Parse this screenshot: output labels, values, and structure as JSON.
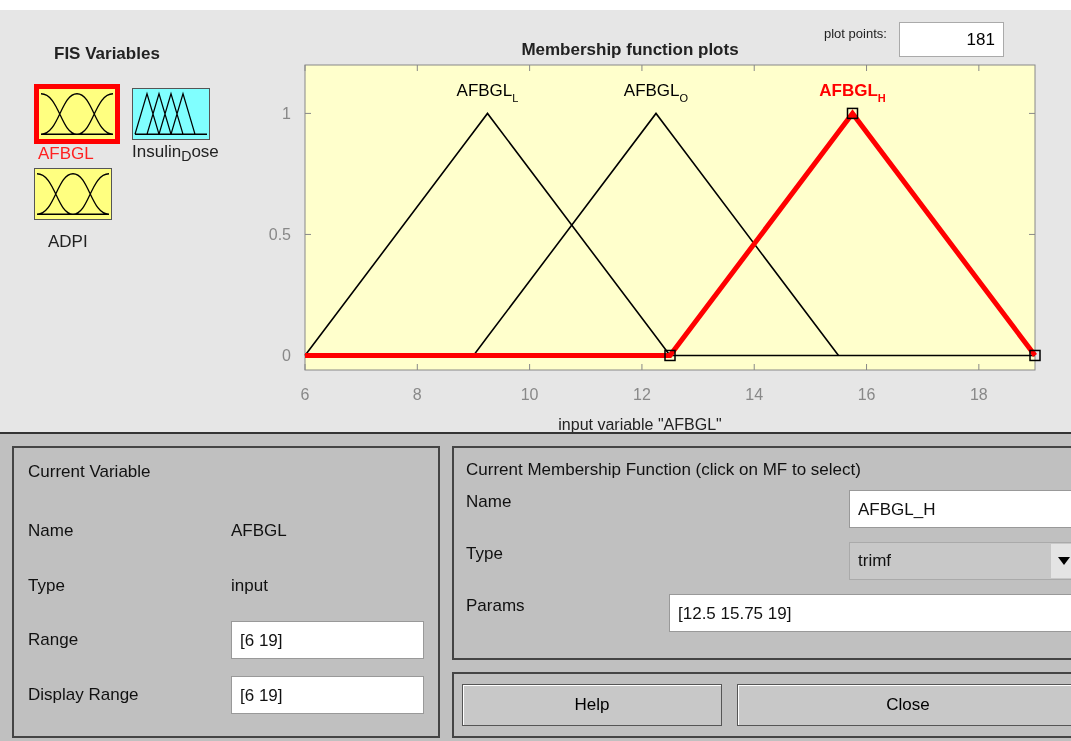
{
  "fis_variables": {
    "title": "FIS Variables",
    "items": [
      {
        "label": "AFBGL",
        "kind": "input",
        "color": "#ffff80",
        "selected": true
      },
      {
        "label": "Insulin$_{D}$ose",
        "kind": "output",
        "color": "#80ffff",
        "selected": false
      },
      {
        "label": "ADPI",
        "kind": "input",
        "color": "#ffff80",
        "selected": false
      }
    ]
  },
  "plot_points": {
    "label": "plot points:",
    "value": "181"
  },
  "chart_data": {
    "type": "line",
    "title": "Membership function plots",
    "xlabel": "input variable \"AFBGL\"",
    "x": [
      6,
      9,
      9.25,
      12.25,
      12.5,
      15.5,
      15.75,
      19
    ],
    "xlim": [
      6,
      19
    ],
    "ylim": [
      -0.06,
      1.2
    ],
    "xticks": [
      6,
      8,
      10,
      12,
      14,
      16,
      18
    ],
    "yticks": [
      0,
      0.5,
      1
    ],
    "series": [
      {
        "name": "AFBGL$_{L}$",
        "color": "#000000",
        "values": [
          0,
          0.923,
          1,
          0.077,
          0,
          null,
          null,
          null
        ]
      },
      {
        "name": "AFBGL$_{O}$",
        "color": "#000000",
        "values": [
          0,
          0,
          0.077,
          1,
          0.923,
          0,
          null,
          null
        ]
      },
      {
        "name": "AFBGL$_{H}$",
        "color": "#ff0000",
        "values": [
          0,
          0,
          0,
          0,
          0,
          0.923,
          1,
          0
        ]
      }
    ]
  },
  "curves": [
    {
      "selected": false
    },
    {
      "selected": false
    },
    {
      "selected": true
    }
  ],
  "current_variable": {
    "title": "Current Variable",
    "rows": [
      {
        "label": "Name",
        "kind": "text",
        "value": "AFBGL"
      },
      {
        "label": "Type",
        "kind": "text",
        "value": "input"
      },
      {
        "label": "Range",
        "kind": "field",
        "value": "[6 19]"
      },
      {
        "label": "Display Range",
        "kind": "field",
        "value": "[6 19]"
      }
    ]
  },
  "current_mf": {
    "title": "Current Membership Function (click on MF to select)",
    "rows": [
      {
        "label": "Name",
        "kind": "field",
        "value": "AFBGL_H"
      },
      {
        "label": "Type",
        "kind": "dropdown",
        "value": "trimf"
      },
      {
        "label": "Params",
        "kind": "wide_field",
        "value": "[12.5 15.75 19]"
      }
    ]
  },
  "buttons": [
    "Help",
    "Close"
  ]
}
